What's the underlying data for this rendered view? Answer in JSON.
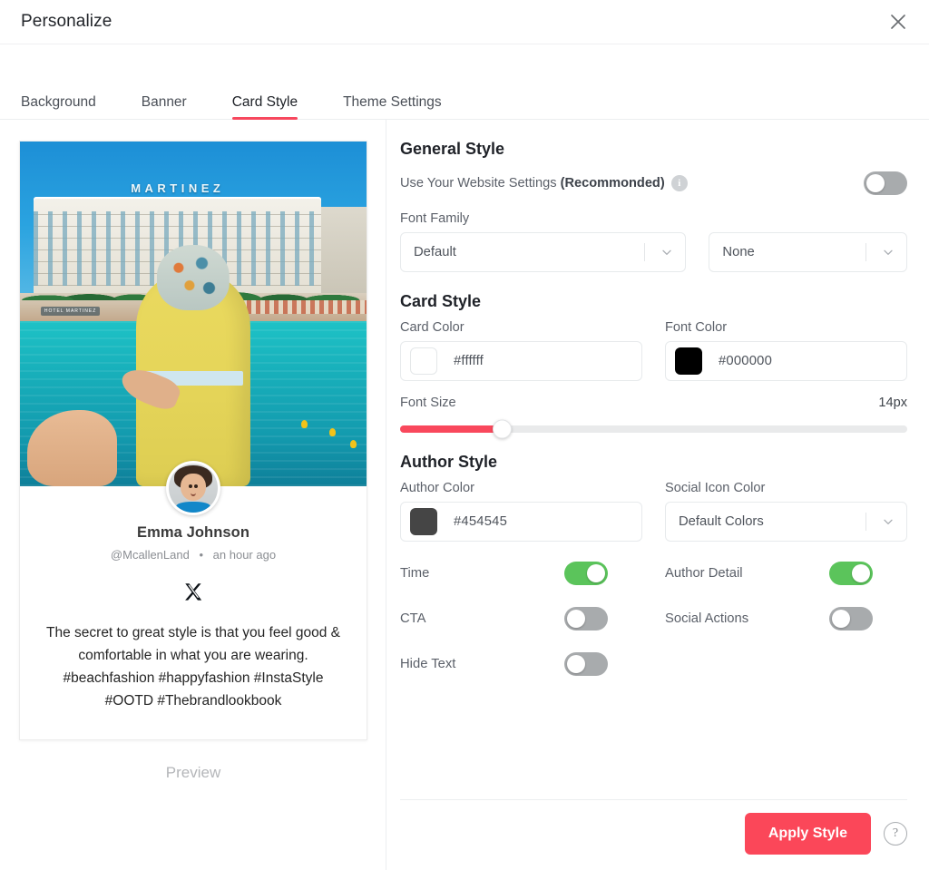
{
  "header": {
    "title": "Personalize",
    "close_label": "×"
  },
  "tabs": [
    {
      "label": "Background",
      "active": false
    },
    {
      "label": "Banner",
      "active": false
    },
    {
      "label": "Card Style",
      "active": true
    },
    {
      "label": "Theme Settings",
      "active": false
    }
  ],
  "preview": {
    "label": "Preview",
    "image_sign": "MARTINEZ",
    "image_sign_small": "HOTEL MARTINEZ",
    "author_name": "Emma Johnson",
    "author_handle": "@McallenLand",
    "separator": "•",
    "timestamp": "an hour ago",
    "social_network": "x-twitter",
    "post_text": "The secret to great style is that you feel good & comfortable in what you are wearing. #beachfashion #happyfashion #InstaStyle #OOTD #Thebrandlookbook"
  },
  "general_style": {
    "title": "General Style",
    "use_website_settings_label": "Use Your Website Settings ",
    "use_website_settings_bold": "(Recommonded)",
    "use_website_settings_on": false,
    "info_glyph": "i",
    "font_family_label": "Font Family",
    "font_family_value": "Default",
    "font_weight_value": "None"
  },
  "card_style": {
    "title": "Card Style",
    "card_color_label": "Card Color",
    "card_color_value": "#ffffff",
    "font_color_label": "Font Color",
    "font_color_value": "#000000",
    "font_size_label": "Font Size",
    "font_size_value": "14px",
    "font_size_percent": 20,
    "slider_accent": "#f9485c"
  },
  "author_style": {
    "title": "Author Style",
    "author_color_label": "Author Color",
    "author_color_value": "#454545",
    "social_icon_color_label": "Social Icon Color",
    "social_icon_color_value": "Default Colors",
    "toggles": [
      {
        "label": "Time",
        "on": true
      },
      {
        "label": "Author Detail",
        "on": true
      },
      {
        "label": "CTA",
        "on": false
      },
      {
        "label": "Social Actions",
        "on": false
      },
      {
        "label": "Hide Text",
        "on": false
      }
    ],
    "toggle_on_color": "#5bc45b",
    "toggle_off_color": "#a8abad"
  },
  "footer": {
    "apply_label": "Apply Style",
    "help_glyph": "?",
    "apply_color": "#fb4759"
  }
}
